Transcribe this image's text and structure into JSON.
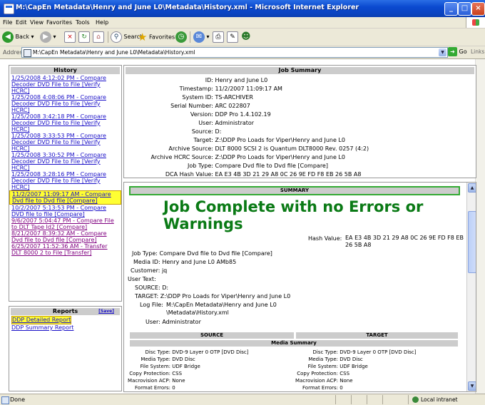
{
  "window": {
    "title": "M:\\CapEn Metadata\\Henry and June L0\\Metadata\\History.xml - Microsoft Internet Explorer"
  },
  "menu": [
    "File",
    "Edit",
    "View",
    "Favorites",
    "Tools",
    "Help"
  ],
  "toolbar": {
    "back": "Back",
    "search": "Search",
    "favorites": "Favorites"
  },
  "address": {
    "label": "Address",
    "value": "M:\\CapEn Metadata\\Henry and June L0\\Metadata\\History.xml",
    "go": "Go",
    "links": "Links"
  },
  "history": {
    "title": "History",
    "items": [
      "1/25/2008 4:12:02 PM - Compare Decoder DVD File to File [Verify HCRC]",
      "1/25/2008 4:08:06 PM - Compare Decoder DVD File to File [Verify HCRC]",
      "1/25/2008 3:42:18 PM - Compare Decoder DVD File to File [Verify HCRC]",
      "1/25/2008 3:33:53 PM - Compare Decoder DVD File to File [Verify HCRC]",
      "1/25/2008 3:30:52 PM - Compare Decoder DVD File to File [Verify HCRC]",
      "1/25/2008 3:28:16 PM - Compare Decoder DVD File to File [Verify HCRC]",
      "11/2/2007 11:09:17 AM - Compare Dvd file to Dvd file [Compare]",
      "10/2/2007 5:13:53 PM - Compare DVD file to file [Compare]",
      "9/6/2007 5:04:47 PM - Compare File to DLT Tape Id2 [Compare]",
      "8/21/2007 8:39:32 AM - Compare Dvd file to Dvd file [Compare]",
      "6/25/2007 11:52:36 AM - Transfer DLT 8000 2 to File [Transfer]"
    ]
  },
  "reports": {
    "title": "Reports",
    "save": "[Save]",
    "items": [
      "DDP Detailed Report",
      "DDP Summary Report"
    ]
  },
  "job_summary": {
    "title": "Job Summary",
    "fields": [
      {
        "k": "ID:",
        "v": "Henry and June L0"
      },
      {
        "k": "Timestamp:",
        "v": "11/2/2007 11:09:17 AM"
      },
      {
        "k": "System ID:",
        "v": "TS-ARCHIVER"
      },
      {
        "k": "Serial Number:",
        "v": "ARC 022807"
      },
      {
        "k": "Version:",
        "v": "DDP Pro 1.4.102.19"
      },
      {
        "k": "User:",
        "v": "Administrator"
      },
      {
        "k": "Source:",
        "v": "D:"
      },
      {
        "k": "Target:",
        "v": "Z:\\DDP Pro Loads for Viper\\Henry and June L0"
      },
      {
        "k": "Archive Source:",
        "v": "DLT 8000 SCSI 2 is Quantum DLT8000 Rev. 0257 (4:2)"
      },
      {
        "k": "Archive HCRC Source:",
        "v": "Z:\\DDP Pro Loads for Viper\\Henry and June L0"
      },
      {
        "k": "Job Type:",
        "v": "Compare Dvd file to Dvd file [Compare]"
      },
      {
        "k": "DCA Hash Value:",
        "v": "EA E3 4B 3D 21 29 A8 0C 26 9E FD F8 EB 26 5B A8"
      }
    ]
  },
  "summary": {
    "title": "SUMMARY",
    "message": "Job Complete with no Errors or Warnings",
    "hash_label": "Hash Value:",
    "hash_value": "EA E3 4B 3D 21 29 A8 0C 26 9E FD F8 EB 26 5B A8",
    "job_type": "Job Type: Compare Dvd file to Dvd file [Compare]",
    "media_id": "Media ID: Henry and June L0 AMb85",
    "customer": "Customer: jq",
    "user_text": "User Text:",
    "source": "SOURCE: D:",
    "target": "TARGET: Z:\\DDP Pro Loads for Viper\\Henry and June L0",
    "logfile_label": "Log File:",
    "logfile_line1": "M:\\CapEn Metadata\\Henry and June L0",
    "logfile_line2": "\\Metadata\\History.xml",
    "user": "User: Administrator",
    "col_source": "SOURCE",
    "col_target": "TARGET",
    "media_summary": "Media Summary",
    "media_rows": [
      {
        "k": "Disc Type:",
        "v": "DVD-9 Layer 0 OTP [DVD Disc]"
      },
      {
        "k": "Media Type:",
        "v": "DVD Disc"
      },
      {
        "k": "File System:",
        "v": "UDF Bridge"
      },
      {
        "k": "Copy Protection:",
        "v": "CSS"
      },
      {
        "k": "Macrovision ACP:",
        "v": "None"
      },
      {
        "k": "Format Errors:",
        "v": "0"
      }
    ]
  },
  "status": {
    "text": "Done",
    "zone": "Local intranet"
  }
}
